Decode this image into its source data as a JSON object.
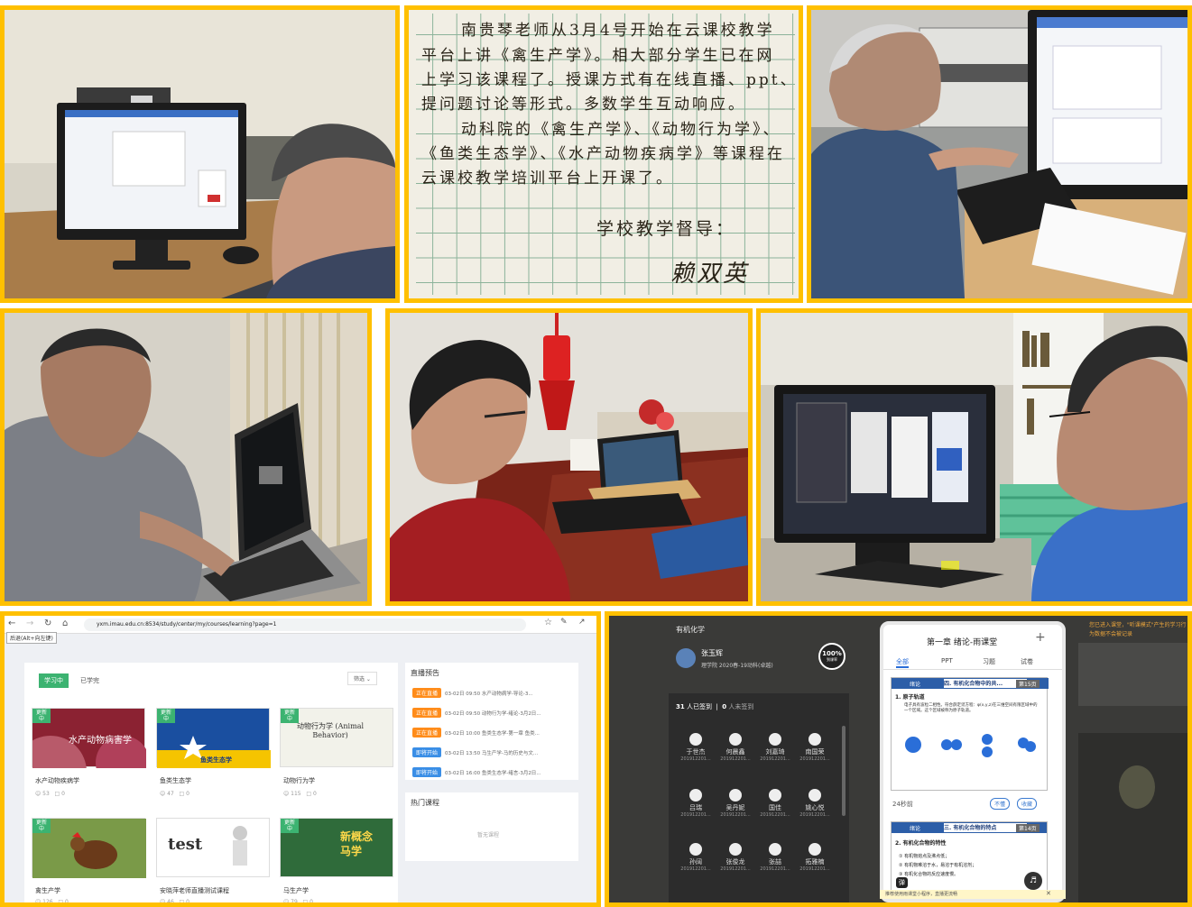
{
  "letter": {
    "lines": [
      "南贵琴老师从3月4号开始在云课校教学",
      "平台上讲《禽生产学》。相大部分学生已在网",
      "上学习该课程了。授课方式有在线直播、ppt、",
      "提问题讨论等形式。多数学生互动响应。",
      "动科院的《禽生产学》、《动物行为学》、",
      "《鱼类生态学》、《水产动物疾病学》等课程在",
      "云课校教学培训平台上开课了。"
    ],
    "sign_label": "学校教学督导：",
    "signature": "赖双英"
  },
  "browser": {
    "tooltip": "后退(Alt+向左键)",
    "url": "yxm.imau.edu.cn:8534/study/center/my/courses/learning?page=1",
    "tab_active": "学习中",
    "tab_done": "已学完",
    "filter": "筛选",
    "courses": [
      {
        "title": "水产动物疾病学",
        "cover": "水产动物病害学",
        "badge": "更新中",
        "views": "53",
        "comments": "0",
        "color": "#8b2232"
      },
      {
        "title": "鱼类生态学",
        "cover": "鱼类生态学",
        "badge": "更新中",
        "views": "47",
        "comments": "0",
        "color": "#1a4fa0"
      },
      {
        "title": "动物行为学",
        "cover": "动物行为学 (Animal Behavior)",
        "badge": "更新中",
        "views": "115",
        "comments": "0",
        "color": "#f2f2ea"
      },
      {
        "title": "禽生产学",
        "cover": "",
        "badge": "更新中",
        "views": "126",
        "comments": "0",
        "color": "#6b8a3a"
      },
      {
        "title": "安晓萍老师直播测试课程",
        "cover": "test",
        "badge": "",
        "views": "46",
        "comments": "0",
        "color": "#ffffff"
      },
      {
        "title": "马生产学",
        "cover": "新概念 马学",
        "badge": "更新中",
        "views": "79",
        "comments": "0",
        "color": "#2f6b3a"
      }
    ],
    "live_title": "直播预告",
    "live": [
      {
        "status": "正在直播",
        "text": "03-02日 09:50 水产动物病学-导论-3...",
        "color": "#ff8c1a"
      },
      {
        "status": "正在直播",
        "text": "03-02日 09:50 动物行为学-绪论-3月2日...",
        "color": "#ff8c1a"
      },
      {
        "status": "正在直播",
        "text": "03-02日 10:00 鱼类生态学-第一章 鱼类...",
        "color": "#ff8c1a"
      },
      {
        "status": "即将开始",
        "text": "03-02日 13:50 马生产学-马的历史与文...",
        "color": "#3a8ee6"
      },
      {
        "status": "即将开始",
        "text": "03-02日 16:00 鱼类生态学-绪言-3月2日...",
        "color": "#3a8ee6"
      }
    ],
    "hot_title": "热门课程",
    "hot_empty": "暂无课程"
  },
  "rain": {
    "course": "有机化学",
    "teacher": "张玉辉",
    "class": "理学院 2020春-19动科(卓越)",
    "percent": "100%",
    "percent_label": "到课率",
    "checked_count": "31",
    "checked_label": "人已签到",
    "unchecked_count": "0",
    "unchecked_label": "人未签到",
    "students": [
      {
        "name": "于世杰",
        "id": "201912201..."
      },
      {
        "name": "何晨鑫",
        "id": "201912201..."
      },
      {
        "name": "刘嘉琦",
        "id": "201912201..."
      },
      {
        "name": "南国荣",
        "id": "201912201..."
      },
      {
        "name": "吕瑞",
        "id": "201912201..."
      },
      {
        "name": "吴丹妮",
        "id": "201912201..."
      },
      {
        "name": "国佳",
        "id": "201912201..."
      },
      {
        "name": "姚心悦",
        "id": "201912201..."
      },
      {
        "name": "孙阔",
        "id": "201912201..."
      },
      {
        "name": "张俊龙",
        "id": "201912201..."
      },
      {
        "name": "张喆",
        "id": "201912201..."
      },
      {
        "name": "拓雅楠",
        "id": "201912201..."
      }
    ],
    "phone_title": "第一章 绪论-雨课堂",
    "phone_tabs": [
      "全部",
      "PPT",
      "习题",
      "试卷"
    ],
    "slide1_tag": "绪论",
    "slide1_title": "四. 有机化合物中的共...",
    "slide1_page": "第15页",
    "slide1_heading": "1. 原子轨道",
    "slide1_body": "电子具有波粒二相性。符合薛定谔方程：φ(x,y,z)在三维空间有限区域中的一个区域。这个区域被称为原子轨道。",
    "slide1_time": "24秒前",
    "btn_unclear": "不懂",
    "btn_fav": "收藏",
    "slide2_tag": "绪论",
    "slide2_title": "三. 有机化合物的特点",
    "slide2_page": "第14页",
    "slide2_heading": "2. 有机化合物的特性",
    "slide2_items": [
      "① 有机物熔点及沸点低；",
      "② 有机物难溶于水，易溶于有机溶剂；",
      "③ 有机化合物的反应速度慢。"
    ],
    "bullet": "弹",
    "footer": "推荐使用雨课堂小程序，直播更流畅",
    "notice": "您已进入课堂，\"听课模式\"产生的学习行为数据不会被记录"
  }
}
